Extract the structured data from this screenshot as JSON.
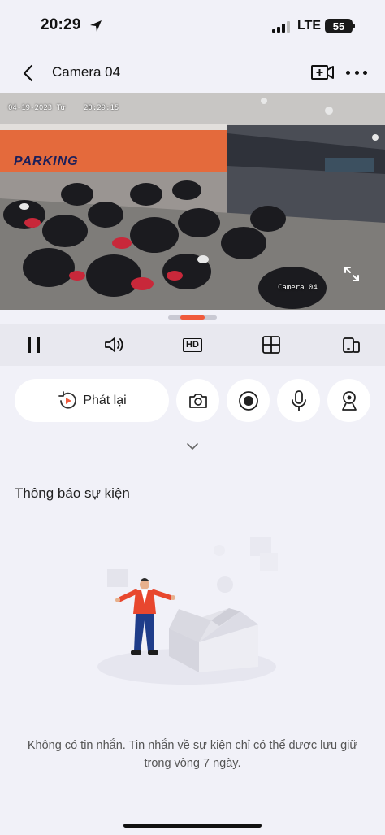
{
  "status_bar": {
    "time": "20:29",
    "network": "LTE",
    "battery": "55"
  },
  "nav": {
    "title": "Camera 04"
  },
  "video": {
    "osd_date": "04-19-2023 Tư",
    "osd_time": "20:29:15",
    "osd_camera": "Camera 04",
    "sign_text": "PARKING"
  },
  "controls": {
    "hd_label": "HD"
  },
  "actions": {
    "playback_label": "Phát lại"
  },
  "events": {
    "section_title": "Thông báo sự kiện",
    "empty_message": "Không có tin nhắn. Tin nhắn về sự kiện chỉ có thể được lưu giữ trong vòng 7 ngày."
  },
  "colors": {
    "accent": "#f05a3c",
    "background": "#f1f1f8",
    "control_bar": "#e8e8ef"
  }
}
